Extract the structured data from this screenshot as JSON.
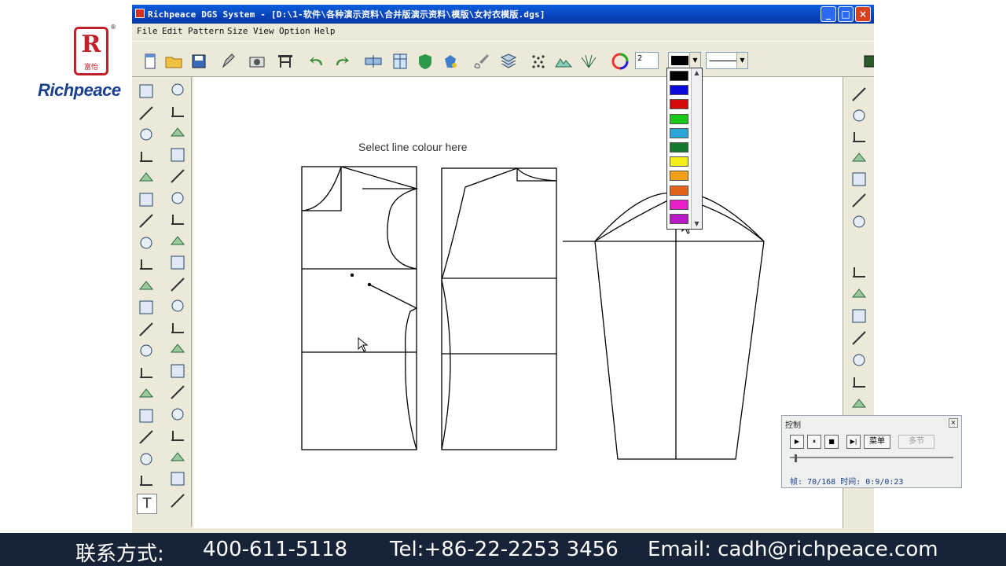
{
  "logo": {
    "brand": "Richpeace",
    "mark_letter": "R",
    "mark_chinese": "富怡",
    "registered": "®"
  },
  "window": {
    "title": "Richpeace DGS System - [D:\\1-软件\\各种演示资料\\合并版演示资料\\模版\\女衬衣模版.dgs]",
    "controls": {
      "minimize": "_",
      "maximize": "□",
      "close": "×"
    }
  },
  "menu": [
    "File",
    "Edit",
    "Pattern",
    "Size",
    "View",
    "Option",
    "Help"
  ],
  "toolbar": {
    "layer_number": "2",
    "current_color": "#000000",
    "line_style": "solid",
    "icons": [
      "new-file-icon",
      "open-folder-icon",
      "save-icon",
      "pencil-edit-icon",
      "camera-icon",
      "grading-table-icon",
      "undo-icon",
      "redo-icon",
      "show-hide-icon",
      "pattern-list-icon",
      "shield-icon",
      "bucket-icon",
      "brush-icon",
      "stack-icon",
      "point-grid-icon",
      "mountain-icon",
      "fan-icon",
      "color-wheel-icon"
    ]
  },
  "canvas": {
    "hint": "Select line colour here"
  },
  "color_palette": {
    "colors": [
      "#000000",
      "#0a0adc",
      "#d40a0a",
      "#18c818",
      "#2aa6d8",
      "#147a30",
      "#f2ee16",
      "#f0a018",
      "#e06418",
      "#e81ec8",
      "#b818c8"
    ]
  },
  "control_panel": {
    "title": "控制",
    "close": "×",
    "buttons": [
      "▶",
      "⏸",
      "■",
      "▶|"
    ],
    "menu_label": "菜单",
    "multi_label": "多节",
    "frame_label": "帧:",
    "frame_value": "70/168",
    "time_label": "时间:",
    "time_value": "0:9/0:23",
    "progress": 0.03
  },
  "footer": {
    "contact_label": "联系方式:",
    "phone": "400-611-5118",
    "tel": "Tel:+86-22-2253 3456",
    "email": "Email: cadh@richpeace.com"
  }
}
